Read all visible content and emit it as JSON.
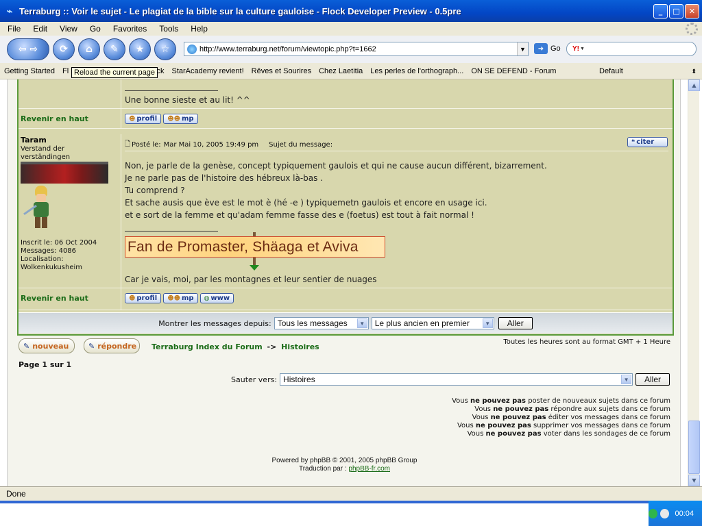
{
  "window": {
    "title": "Terraburg :: Voir le sujet - Le plagiat de la bible sur la culture gauloise - Flock Developer Preview - 0.5pre",
    "min": "_",
    "max": "□",
    "close": "✕"
  },
  "menu": [
    "File",
    "Edit",
    "View",
    "Go",
    "Favorites",
    "Tools",
    "Help"
  ],
  "nav": {
    "url": "http://www.terraburg.net/forum/viewtopic.php?t=1662",
    "go_label": "Go",
    "search_brand": "Y!"
  },
  "bookmarks": [
    "Getting Started",
    "Fl",
    "Feedback",
    "StarAcademy revient!",
    "Rêves et Sourires",
    "Chez Laetitia",
    "Les perles de l'orthograph...",
    "ON SE DEFEND - Forum"
  ],
  "bookmarks_folder": "Default",
  "tooltip": "Reload the current page",
  "prev_post": {
    "signature": "Une bonne sieste et au lit! ^^",
    "back_to_top": "Revenir en haut",
    "buttons": [
      "profil",
      "mp"
    ]
  },
  "post": {
    "author": "Taram",
    "rank": "Verstand der verständingen",
    "meta_label": "Posté le:",
    "date": "Mar Mai 10, 2005 19:49 pm",
    "subject_label": "Sujet du message:",
    "quote_button": "citer",
    "lines": [
      "Non, je parle de la genèse, concept typiquement gaulois et qui ne cause aucun différent, bizarrement.",
      "Je ne parle pas de l'histoire des hébreux là-bas .",
      "Tu comprend ?",
      "Et sache ausis que ève est le mot è (hé -e ) typiquemetn gaulois et encore en usage ici.",
      "et e sort de la femme et qu'adam femme fasse des e (foetus) est tout à fait normal !"
    ],
    "banner": "Fan de Promaster, Shäaga et Aviva",
    "signature": "Car je vais, moi, par les montagnes et leur sentier de nuages",
    "joined": "Inscrit le: 06 Oct 2004",
    "messages": "Messages: 4086",
    "location_label": "Localisation:",
    "location": "Wolkenkukusheim",
    "back_to_top": "Revenir en haut",
    "buttons": [
      "profil",
      "mp",
      "www"
    ]
  },
  "filter": {
    "label": "Montrer les messages depuis:",
    "select1": "Tous les messages",
    "select2": "Le plus ancien en premier",
    "button": "Aller"
  },
  "actions": {
    "new": "nouveau",
    "reply": "répondre",
    "forum_index": "Terraburg Index du Forum",
    "arrow": "->",
    "forum": "Histoires",
    "timezone": "Toutes les heures sont au format GMT + 1 Heure",
    "page": "Page 1 sur 1"
  },
  "jump": {
    "label": "Sauter vers:",
    "value": "Histoires",
    "button": "Aller"
  },
  "permissions": [
    {
      "pre": "Vous ",
      "bold": "ne pouvez pas",
      "post": " poster de nouveaux sujets dans ce forum"
    },
    {
      "pre": "Vous ",
      "bold": "ne pouvez pas",
      "post": " répondre aux sujets dans ce forum"
    },
    {
      "pre": "Vous ",
      "bold": "ne pouvez pas",
      "post": " éditer vos messages dans ce forum"
    },
    {
      "pre": "Vous ",
      "bold": "ne pouvez pas",
      "post": " supprimer vos messages dans ce forum"
    },
    {
      "pre": "Vous ",
      "bold": "ne pouvez pas",
      "post": " voter dans les sondages de ce forum"
    }
  ],
  "footer": {
    "powered": "Powered by phpBB © 2001, 2005 phpBB Group",
    "translation": "Traduction par :",
    "translation_link": "phpBB-fr.com"
  },
  "status": "Done",
  "clock": "00:04"
}
